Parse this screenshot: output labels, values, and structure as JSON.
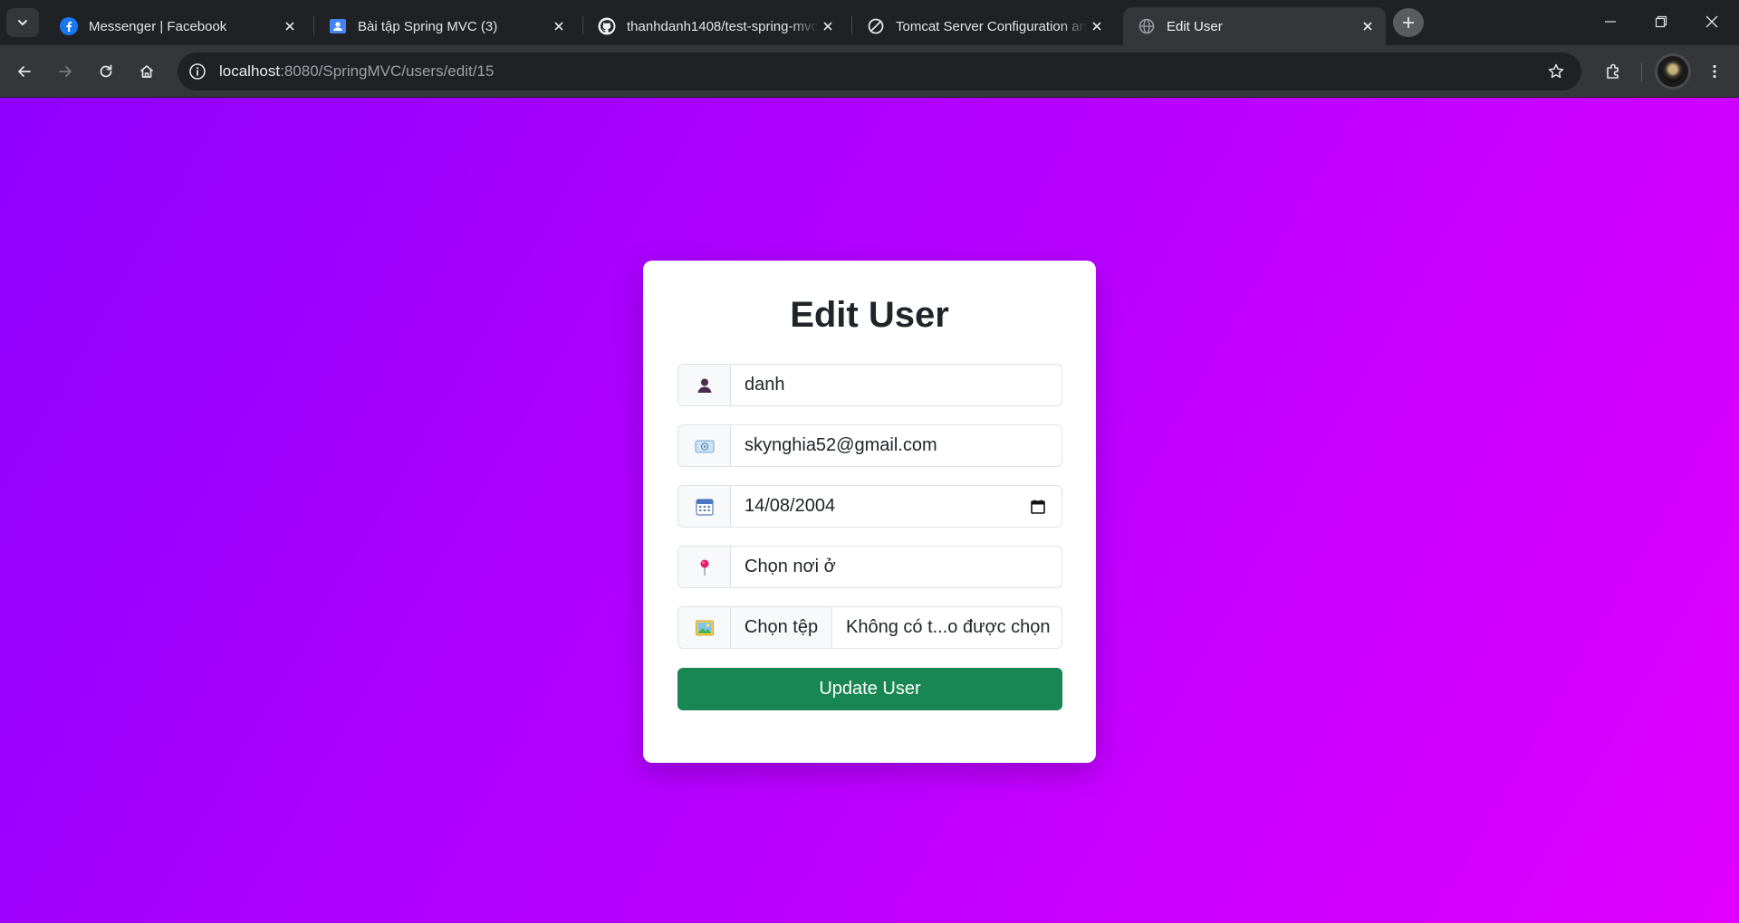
{
  "browser": {
    "tabs": [
      {
        "title": "Messenger | Facebook",
        "favicon": "facebook-icon"
      },
      {
        "title": "Bài tập Spring MVC (3)",
        "favicon": "classroom-icon"
      },
      {
        "title": "thanhdanh1408/test-spring-mvc",
        "favicon": "github-icon"
      },
      {
        "title": "Tomcat Server Configuration and",
        "favicon": "tomcat-icon"
      },
      {
        "title": "Edit User",
        "favicon": "globe-icon",
        "active": true
      }
    ],
    "address": {
      "host": "localhost",
      "path": ":8080/SpringMVC/users/edit/15"
    }
  },
  "form": {
    "heading": "Edit User",
    "username": "danh",
    "email": "skynghia52@gmail.com",
    "birthdate": "14/08/2004",
    "address_placeholder": "Chọn nơi ở",
    "file_button": "Chọn tệp",
    "file_name": "Không có t...o được chọn",
    "submit_label": "Update User"
  },
  "colors": {
    "background_start": "#8f00ff",
    "background_end": "#e000ff",
    "submit": "#198754",
    "chrome_dark": "#202124",
    "chrome_toolbar": "#35363a"
  }
}
